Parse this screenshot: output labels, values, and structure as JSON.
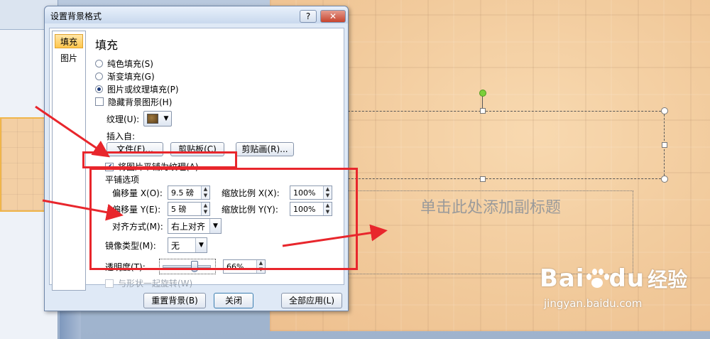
{
  "dialog": {
    "title": "设置背景格式",
    "help_label": "?",
    "close_label": "✕",
    "nav": [
      {
        "label": "填充",
        "active": true
      },
      {
        "label": "图片",
        "active": false
      }
    ],
    "section_title": "填充",
    "fill_options": [
      {
        "label": "纯色填充(S)",
        "selected": false
      },
      {
        "label": "渐变填充(G)",
        "selected": false
      },
      {
        "label": "图片或纹理填充(P)",
        "selected": true
      }
    ],
    "hide_bg_graphics": {
      "label": "隐藏背景图形(H)",
      "checked": false
    },
    "texture_label": "纹理(U):",
    "insert_from_label": "插入自:",
    "insert_buttons": {
      "file": "文件(F)...",
      "clipboard": "剪贴板(C)",
      "clipart": "剪贴画(R)..."
    },
    "tile_checkbox": {
      "label": "将图片平铺为纹理(A)",
      "checked": true
    },
    "tile_options_title": "平铺选项",
    "offset_x": {
      "label": "偏移量 X(O):",
      "value": "9.5 磅"
    },
    "offset_y": {
      "label": "偏移量 Y(E):",
      "value": "5 磅"
    },
    "scale_x": {
      "label": "缩放比例 X(X):",
      "value": "100%"
    },
    "scale_y": {
      "label": "缩放比例 Y(Y):",
      "value": "100%"
    },
    "alignment": {
      "label": "对齐方式(M):",
      "value": "右上对齐"
    },
    "mirror": {
      "label": "镜像类型(M):",
      "value": "无"
    },
    "transparency": {
      "label": "透明度(T):",
      "value": "66%",
      "fraction": 0.66
    },
    "rotate_with_shape": {
      "label": "与形状一起旋转(W)",
      "checked": false,
      "disabled": true
    },
    "footer_buttons": {
      "reset": "重置背景(B)",
      "close": "关闭",
      "apply_all": "全部应用(L)"
    }
  },
  "slide": {
    "subtitle_placeholder": "单击此处添加副标题"
  },
  "watermark": {
    "brand": "Bai",
    "brand_suffix": "du",
    "brand_cn": "经验",
    "site": "jingyan.baidu.com"
  },
  "colors": {
    "highlight_red": "#e8262c",
    "nav_active": "#ffc64c",
    "slide_bg": "#f1c99a",
    "rotation_handle": "#7ccf3a"
  }
}
